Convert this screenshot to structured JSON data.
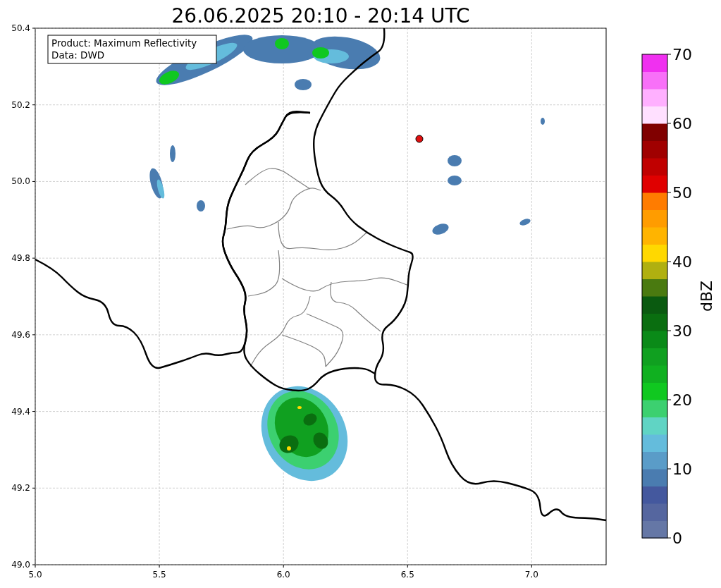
{
  "title": "26.06.2025 20:10 - 20:14 UTC",
  "info_box": [
    "Product: Maximum Reflectivity",
    "Data: DWD"
  ],
  "map": {
    "xticks": [
      "5.0",
      "5.5",
      "6.0",
      "6.5",
      "7.0"
    ],
    "yticks": [
      "50.4",
      "50.2",
      "50.0",
      "49.8",
      "49.6",
      "49.4",
      "49.2",
      "49.0"
    ]
  },
  "colorbar": {
    "label": "dBZ",
    "ticks": [
      "70",
      "60",
      "50",
      "40",
      "30",
      "20",
      "10",
      "0"
    ]
  }
}
